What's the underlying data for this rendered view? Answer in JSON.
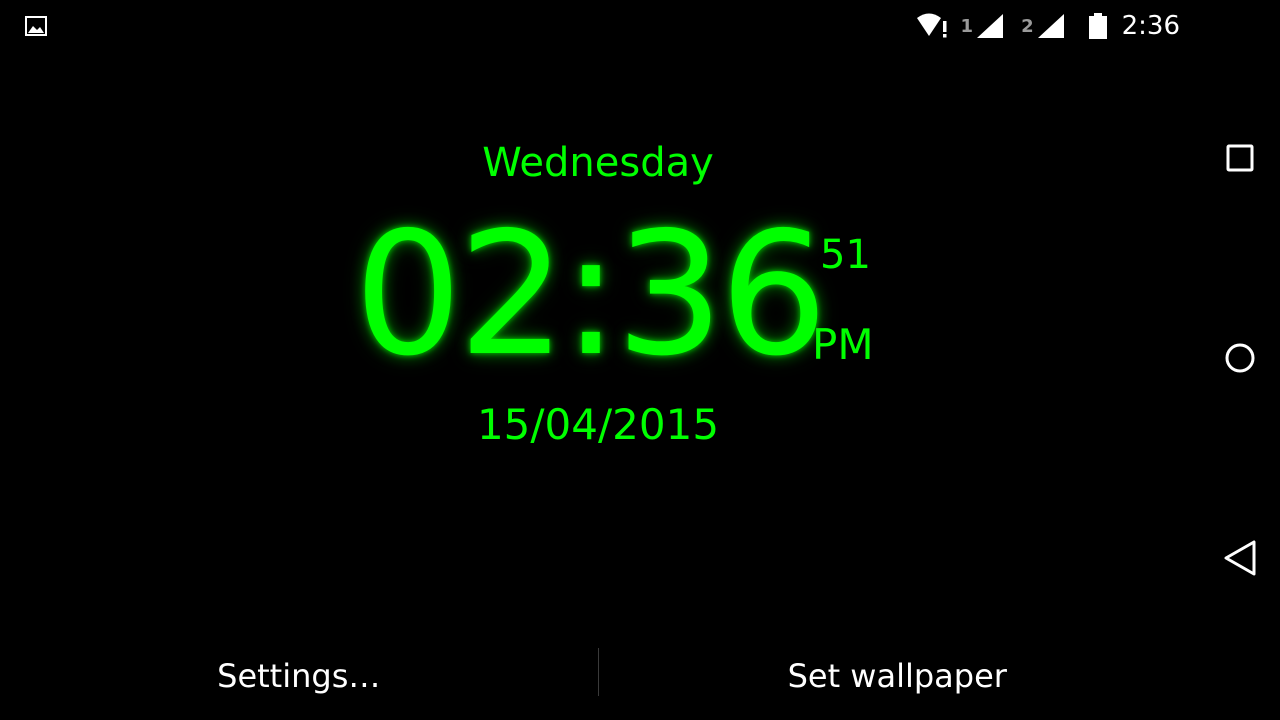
{
  "status_bar": {
    "notification_icon": "image-icon",
    "wifi_icon": "wifi-alert-icon",
    "sim1_label": "1",
    "sim2_label": "2",
    "signal_icon": "cell-signal-icon",
    "battery_icon": "battery-icon",
    "time": "2:36"
  },
  "clock": {
    "day": "Wednesday",
    "time": "02:36",
    "seconds": "51",
    "ampm": "PM",
    "date": "15/04/2015"
  },
  "actions": {
    "settings_label": "Settings…",
    "set_wallpaper_label": "Set wallpaper"
  },
  "nav_bar": {
    "recents_icon": "square-icon",
    "home_icon": "circle-icon",
    "back_icon": "triangle-back-icon"
  },
  "colors": {
    "background": "#000000",
    "clock_green": "#00ff00",
    "text_white": "#ffffff"
  }
}
